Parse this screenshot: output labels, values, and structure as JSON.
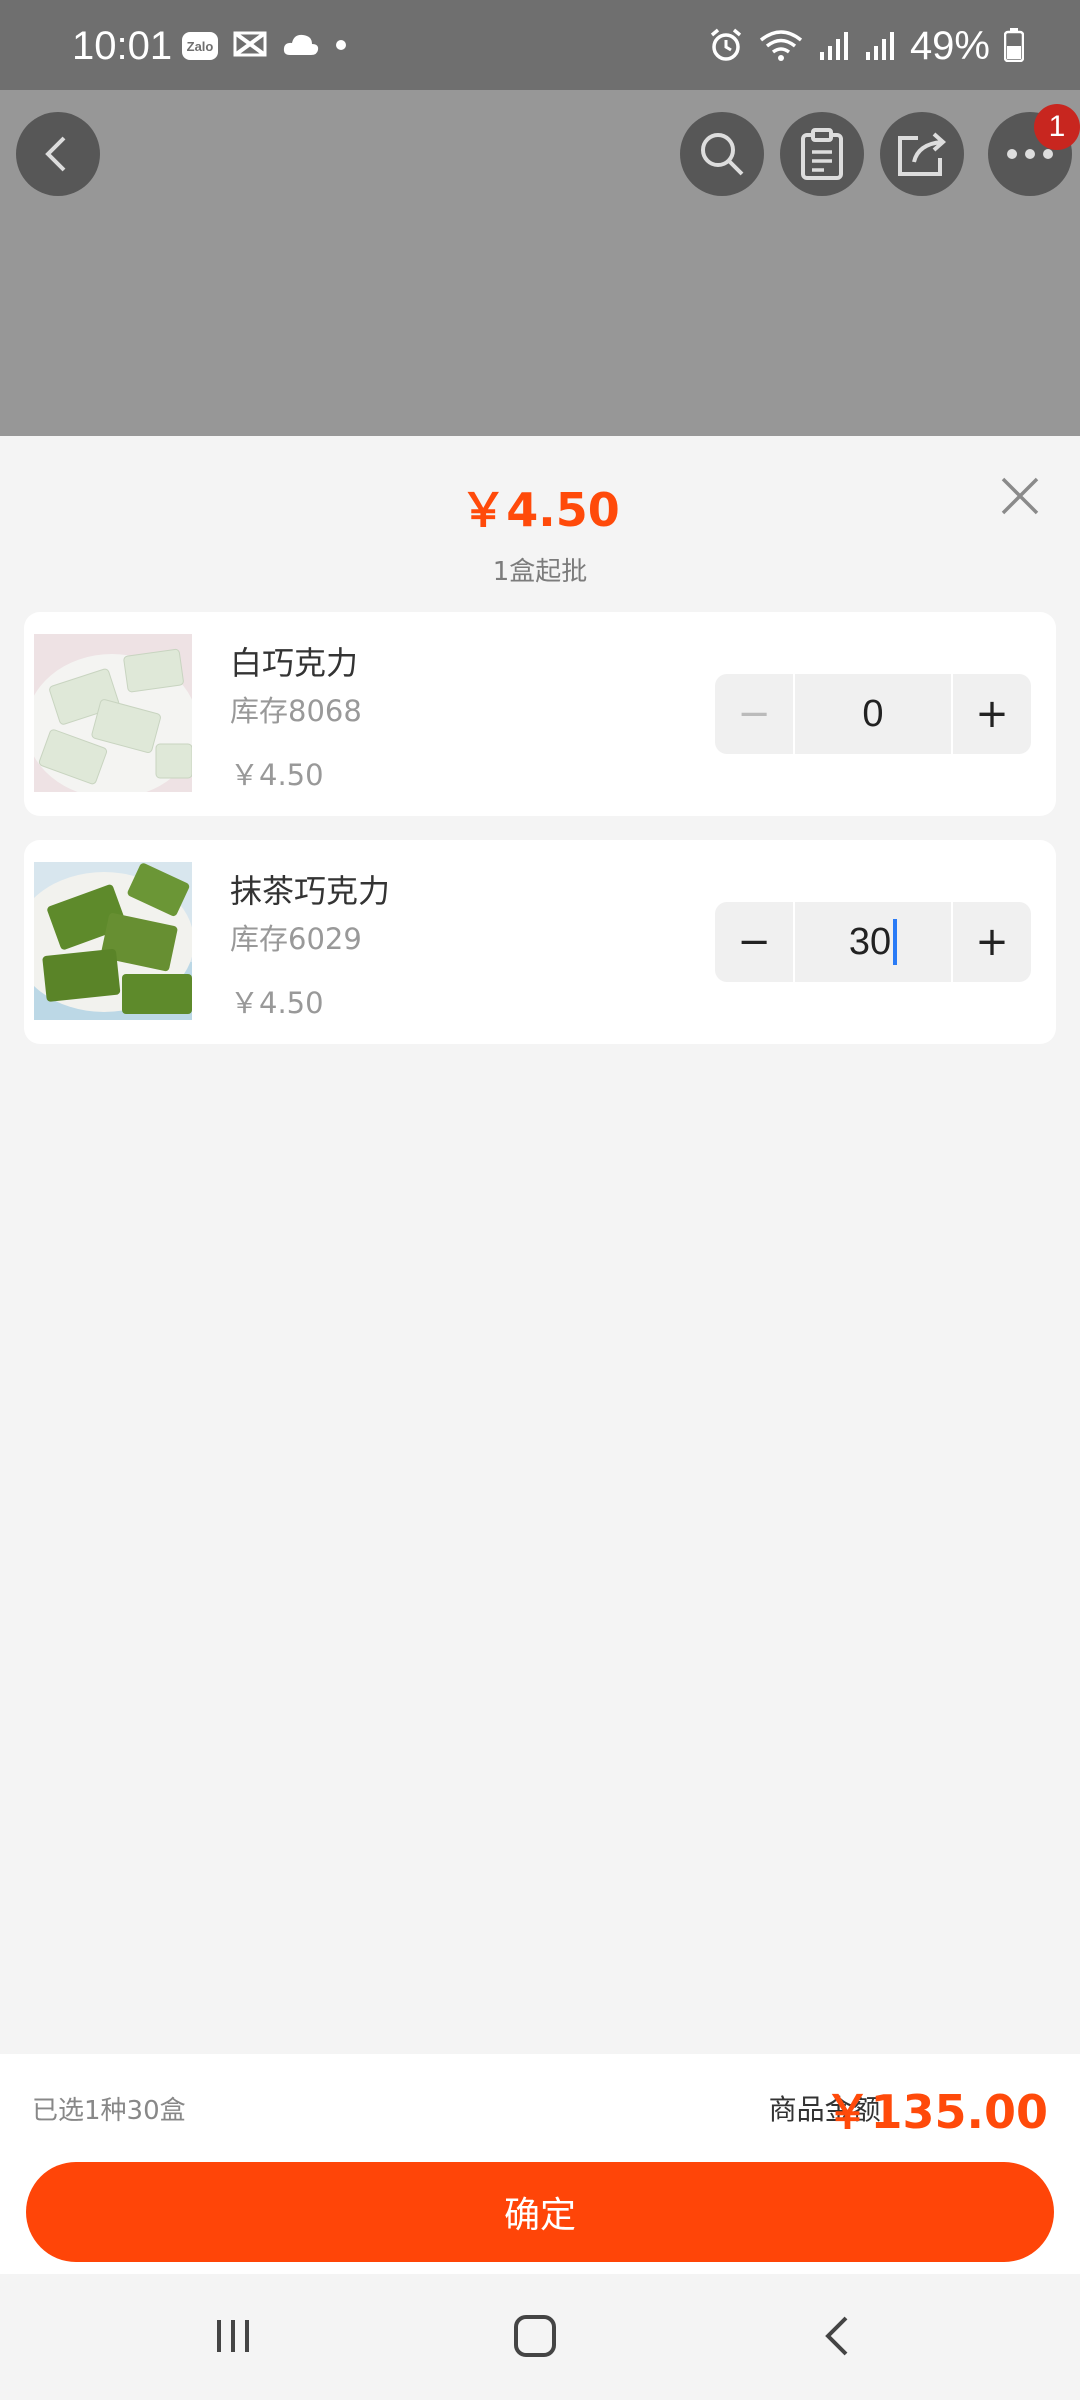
{
  "status_bar": {
    "time": "10:01",
    "zalo_label": "Zalo",
    "battery": "49%"
  },
  "top_nav": {
    "notification_count": "1"
  },
  "sheet": {
    "price": "￥4.50",
    "min_order": "1盒起批"
  },
  "products": [
    {
      "name": "白巧克力",
      "stock": "库存8068",
      "price": "￥4.50",
      "quantity": "0",
      "thumb_color": "#dfe8d8"
    },
    {
      "name": "抹茶巧克力",
      "stock": "库存6029",
      "price": "￥4.50",
      "quantity": "30",
      "thumb_color": "#5e8a2b"
    }
  ],
  "summary": {
    "selected": "已选1种30盒",
    "total_label": "商品金额:",
    "total_value": "￥135.00"
  },
  "confirm_label": "确定",
  "colors": {
    "accent": "#ff4508",
    "price": "#ff4a0a"
  }
}
